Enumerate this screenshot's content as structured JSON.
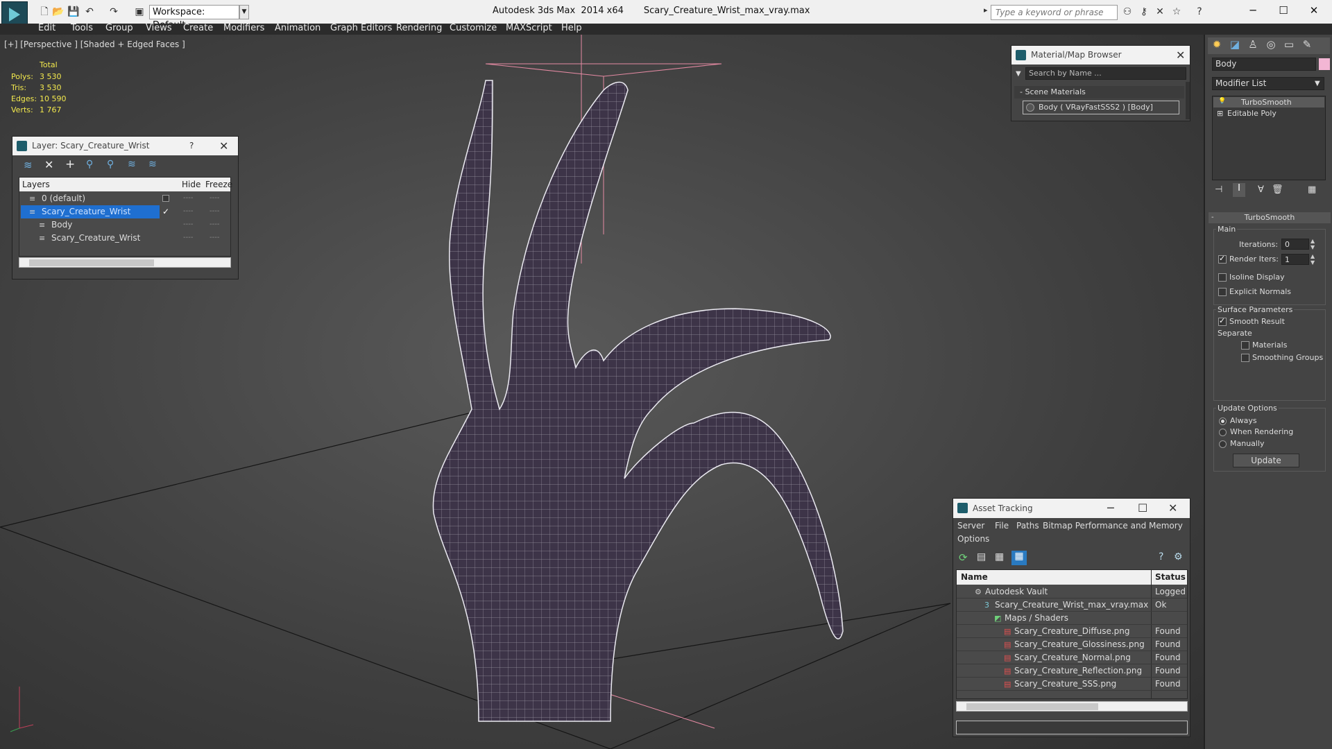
{
  "titlebar": {
    "workspace": "Workspace: Default",
    "app_title": "Autodesk 3ds Max  2014 x64",
    "file_title": "Scary_Creature_Wrist_max_vray.max",
    "search_placeholder": "Type a keyword or phrase",
    "min": "─",
    "max": "☐",
    "close": "✕"
  },
  "menu": [
    "Edit",
    "Tools",
    "Group",
    "Views",
    "Create",
    "Modifiers",
    "Animation",
    "Graph Editors",
    "Rendering",
    "Customize",
    "MAXScript",
    "Help"
  ],
  "viewport": {
    "label": "[+] [Perspective ] [Shaded + Edged Faces ]",
    "stats": {
      "total": "Total",
      "rows": [
        [
          "Polys:",
          "3 530"
        ],
        [
          "Tris:",
          "3 530"
        ],
        [
          "Edges:",
          "10 590"
        ],
        [
          "Verts:",
          "1 767"
        ]
      ]
    }
  },
  "layer_panel": {
    "title": "Layer: Scary_Creature_Wrist",
    "help": "?",
    "close": "✕",
    "cols": [
      "Layers",
      "Hide",
      "Freeze"
    ],
    "rows": [
      {
        "name": "0 (default)",
        "indent": 1,
        "selected": false
      },
      {
        "name": "Scary_Creature_Wrist",
        "indent": 1,
        "selected": true
      },
      {
        "name": "Body",
        "indent": 2,
        "selected": false
      },
      {
        "name": "Scary_Creature_Wrist",
        "indent": 2,
        "selected": false
      }
    ],
    "dash": "----"
  },
  "material_browser": {
    "title": "Material/Map Browser",
    "close": "✕",
    "search_placeholder": "Search by Name ...",
    "section": "- Scene Materials",
    "item": "Body  ( VRayFastSSS2 )  [Body]"
  },
  "asset_tracking": {
    "title": "Asset Tracking",
    "menu": [
      "Server",
      "File",
      "Paths",
      "Bitmap Performance and Memory"
    ],
    "menu2": "Options",
    "cols": [
      "Name",
      "Status"
    ],
    "rows": [
      {
        "name": "Autodesk Vault",
        "status": "Logged O",
        "indent": 1,
        "icon": "vault"
      },
      {
        "name": "Scary_Creature_Wrist_max_vray.max",
        "status": "Ok",
        "indent": 2,
        "icon": "max"
      },
      {
        "name": "Maps / Shaders",
        "status": "",
        "indent": 3,
        "icon": "maps"
      },
      {
        "name": "Scary_Creature_Diffuse.png",
        "status": "Found",
        "indent": 4,
        "icon": "png"
      },
      {
        "name": "Scary_Creature_Glossiness.png",
        "status": "Found",
        "indent": 4,
        "icon": "png"
      },
      {
        "name": "Scary_Creature_Normal.png",
        "status": "Found",
        "indent": 4,
        "icon": "png"
      },
      {
        "name": "Scary_Creature_Reflection.png",
        "status": "Found",
        "indent": 4,
        "icon": "png"
      },
      {
        "name": "Scary_Creature_SSS.png",
        "status": "Found",
        "indent": 4,
        "icon": "png"
      }
    ]
  },
  "command_panel": {
    "object_name": "Body",
    "modifier_list": "Modifier List",
    "stack": [
      "TurboSmooth",
      "Editable Poly"
    ],
    "rollout": "TurboSmooth",
    "main": "Main",
    "iterations_label": "Iterations:",
    "iterations": "0",
    "render_iters_label": "Render Iters:",
    "render_iters": "1",
    "isoline": "Isoline Display",
    "explicit": "Explicit Normals",
    "surface": "Surface Parameters",
    "smooth_result": "Smooth Result",
    "separate": "Separate",
    "materials": "Materials",
    "smoothing_groups": "Smoothing Groups",
    "update_options": "Update Options",
    "always": "Always",
    "when_rendering": "When Rendering",
    "manually": "Manually",
    "update": "Update"
  }
}
